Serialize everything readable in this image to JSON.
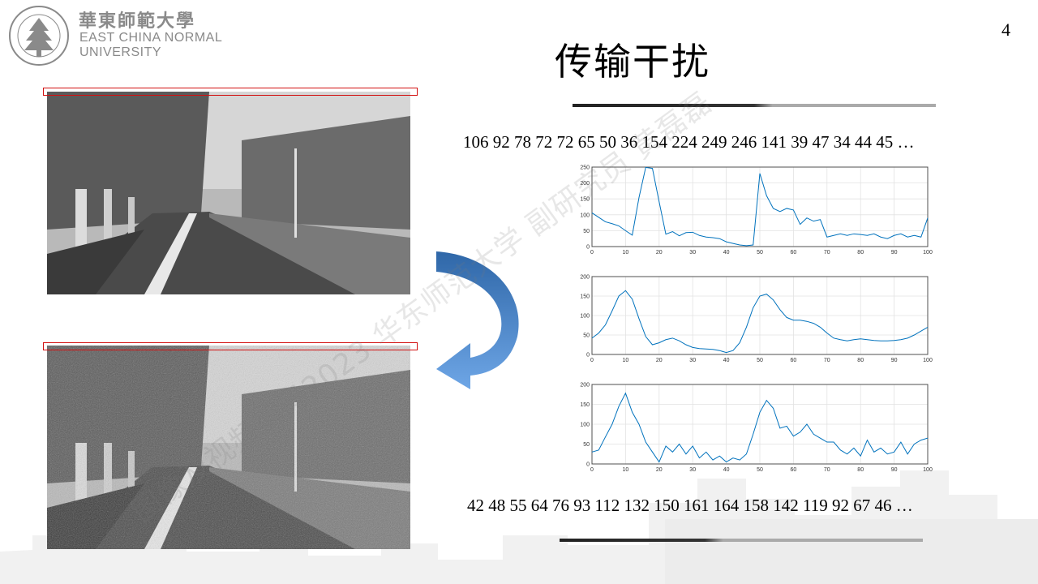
{
  "header": {
    "logo_cn": "華東師範大學",
    "logo_en_line1": "EAST CHINA NORMAL",
    "logo_en_line2": "UNIVERSITY",
    "seal_text": "EAST CHINA NORMAL UNIVERSITY"
  },
  "page_number": "4",
  "title": "传输干扰",
  "sequence_top": "106 92 78 72 72 65 50 36 154 224 249 246 141 39 47 34 44 45 …",
  "sequence_bottom": "42 48 55 64 76 93 112 132 150 161 164 158 142 119 92 67 46 …",
  "watermark": "图像及视频编码2023 华东师范大学 副研究员 黄磊磊",
  "colors": {
    "line": "#0072bd",
    "arrow": "#3f7fc7",
    "redbox": "#d21010"
  },
  "chart_data": [
    {
      "type": "line",
      "x": [
        0,
        2,
        4,
        6,
        8,
        10,
        12,
        14,
        16,
        18,
        20,
        22,
        24,
        26,
        28,
        30,
        32,
        34,
        36,
        38,
        40,
        42,
        44,
        46,
        48,
        50,
        52,
        54,
        56,
        58,
        60,
        62,
        64,
        66,
        68,
        70,
        72,
        74,
        76,
        78,
        80,
        82,
        84,
        86,
        88,
        90,
        92,
        94,
        96,
        98,
        100
      ],
      "y": [
        106,
        92,
        78,
        72,
        65,
        50,
        36,
        154,
        249,
        246,
        141,
        39,
        47,
        34,
        44,
        45,
        35,
        30,
        28,
        25,
        15,
        10,
        5,
        3,
        5,
        230,
        160,
        120,
        110,
        120,
        115,
        70,
        90,
        80,
        85,
        30,
        35,
        40,
        35,
        40,
        38,
        35,
        40,
        30,
        25,
        35,
        40,
        30,
        35,
        30,
        90
      ],
      "xlim": [
        0,
        100
      ],
      "ylim": [
        0,
        250
      ],
      "xticks": [
        0,
        10,
        20,
        30,
        40,
        50,
        60,
        70,
        80,
        90,
        100
      ],
      "yticks": [
        0,
        50,
        100,
        150,
        200,
        250
      ],
      "grid": true
    },
    {
      "type": "line",
      "x": [
        0,
        2,
        4,
        6,
        8,
        10,
        12,
        14,
        16,
        18,
        20,
        22,
        24,
        26,
        28,
        30,
        32,
        34,
        36,
        38,
        40,
        42,
        44,
        46,
        48,
        50,
        52,
        54,
        56,
        58,
        60,
        62,
        64,
        66,
        68,
        70,
        72,
        74,
        76,
        78,
        80,
        82,
        84,
        86,
        88,
        90,
        92,
        94,
        96,
        98,
        100
      ],
      "y": [
        42,
        55,
        76,
        112,
        150,
        164,
        142,
        92,
        46,
        25,
        30,
        38,
        42,
        35,
        25,
        18,
        15,
        14,
        13,
        10,
        5,
        10,
        30,
        70,
        120,
        150,
        155,
        140,
        115,
        95,
        88,
        88,
        85,
        80,
        70,
        55,
        42,
        38,
        35,
        38,
        40,
        38,
        36,
        35,
        35,
        36,
        38,
        42,
        50,
        60,
        70
      ],
      "xlim": [
        0,
        100
      ],
      "ylim": [
        0,
        200
      ],
      "xticks": [
        0,
        10,
        20,
        30,
        40,
        50,
        60,
        70,
        80,
        90,
        100
      ],
      "yticks": [
        0,
        50,
        100,
        150,
        200
      ],
      "grid": true
    },
    {
      "type": "line",
      "x": [
        0,
        2,
        4,
        6,
        8,
        10,
        12,
        14,
        16,
        18,
        20,
        22,
        24,
        26,
        28,
        30,
        32,
        34,
        36,
        38,
        40,
        42,
        44,
        46,
        48,
        50,
        52,
        54,
        56,
        58,
        60,
        62,
        64,
        66,
        68,
        70,
        72,
        74,
        76,
        78,
        80,
        82,
        84,
        86,
        88,
        90,
        92,
        94,
        96,
        98,
        100
      ],
      "y": [
        30,
        35,
        68,
        100,
        145,
        178,
        130,
        100,
        55,
        30,
        5,
        45,
        30,
        50,
        25,
        45,
        15,
        30,
        10,
        20,
        5,
        15,
        10,
        25,
        75,
        130,
        160,
        140,
        90,
        95,
        70,
        80,
        100,
        75,
        65,
        55,
        55,
        35,
        25,
        40,
        20,
        60,
        30,
        40,
        25,
        30,
        55,
        25,
        50,
        60,
        65
      ],
      "xlim": [
        0,
        100
      ],
      "ylim": [
        0,
        200
      ],
      "xticks": [
        0,
        10,
        20,
        30,
        40,
        50,
        60,
        70,
        80,
        90,
        100
      ],
      "yticks": [
        0,
        50,
        100,
        150,
        200
      ],
      "grid": true
    }
  ]
}
